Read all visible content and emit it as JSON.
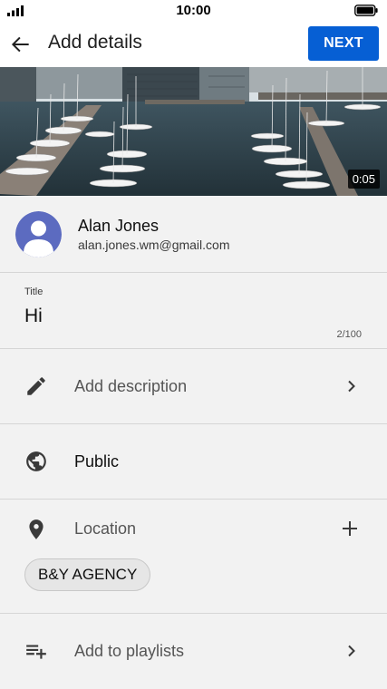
{
  "status_bar": {
    "time": "10:00"
  },
  "app_bar": {
    "title": "Add details",
    "next_label": "NEXT"
  },
  "video": {
    "duration": "0:05"
  },
  "account": {
    "name": "Alan Jones",
    "email": "alan.jones.wm@gmail.com"
  },
  "title_field": {
    "label": "Title",
    "value": "Hi",
    "counter": "2/100"
  },
  "rows": {
    "description": {
      "label": "Add description"
    },
    "visibility": {
      "label": "Public"
    },
    "location": {
      "label": "Location",
      "chip": "B&Y AGENCY"
    },
    "playlists": {
      "label": "Add to playlists"
    }
  },
  "colors": {
    "accent": "#065fd4",
    "background": "#f2f2f2",
    "avatar": "#5c6bc0"
  },
  "icons": [
    "signal-icon",
    "battery-icon",
    "back-arrow-icon",
    "pencil-icon",
    "globe-icon",
    "location-pin-icon",
    "plus-icon",
    "playlist-add-icon",
    "chevron-right-icon"
  ]
}
